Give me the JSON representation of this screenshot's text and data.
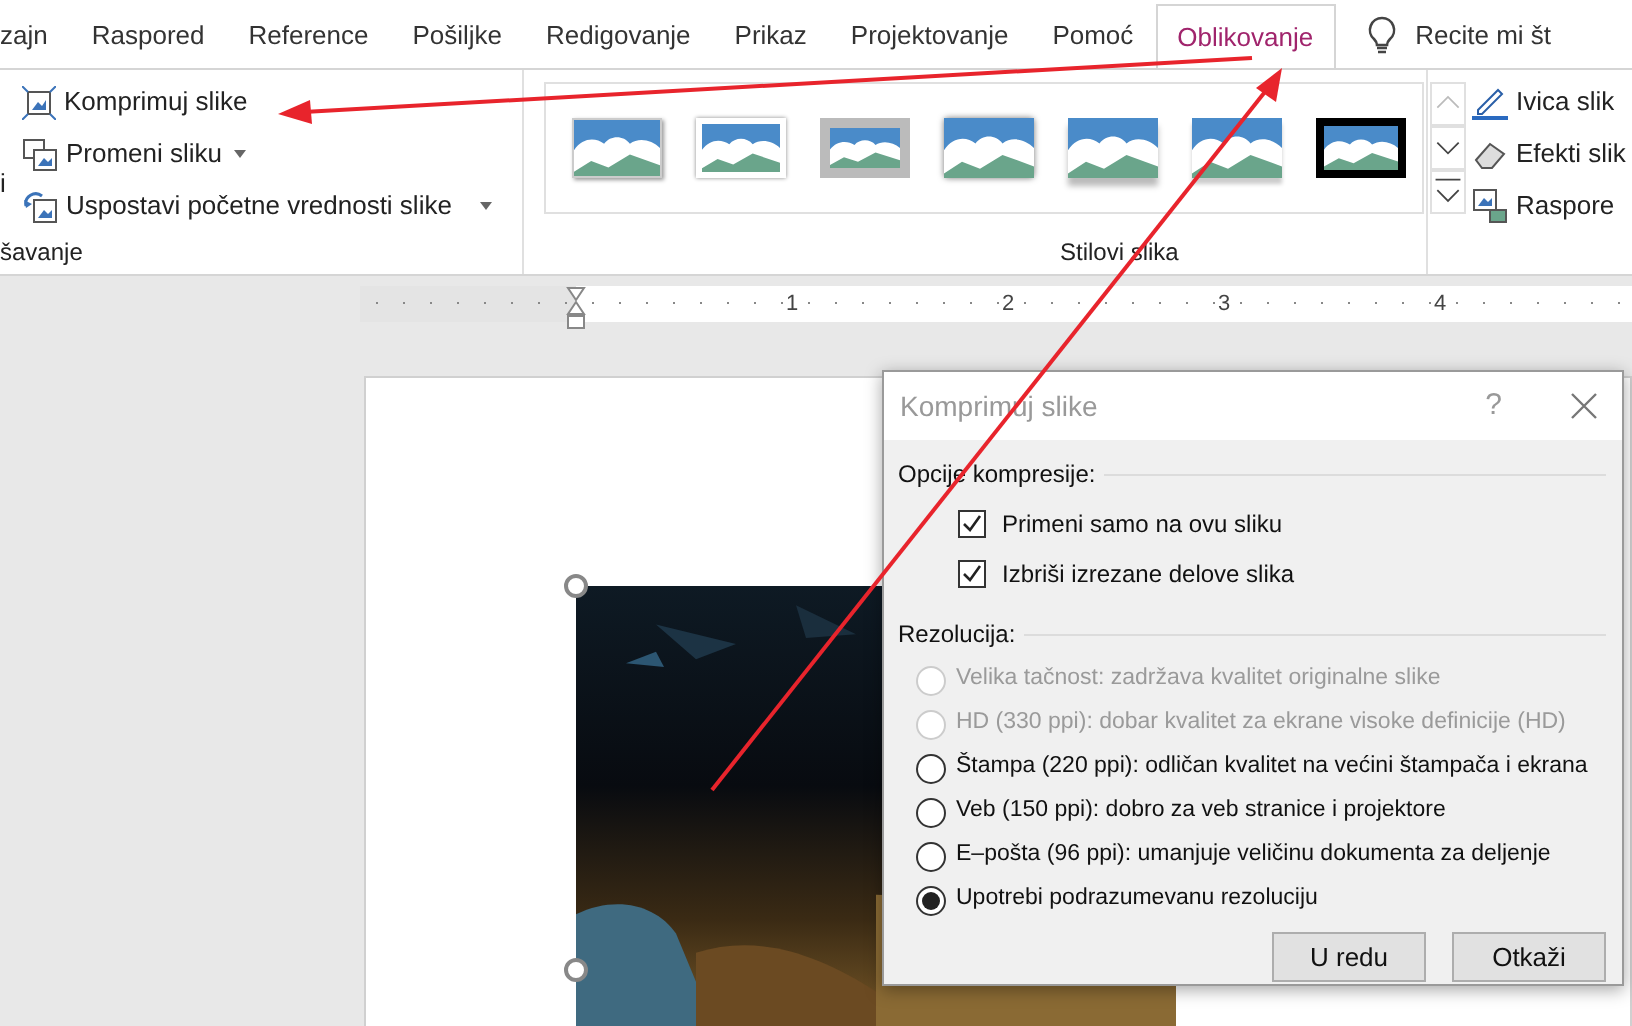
{
  "tabs": [
    {
      "label": "zajn",
      "selected": false
    },
    {
      "label": "Raspored",
      "selected": false
    },
    {
      "label": "Reference",
      "selected": false
    },
    {
      "label": "Pošiljke",
      "selected": false
    },
    {
      "label": "Redigovanje",
      "selected": false
    },
    {
      "label": "Prikaz",
      "selected": false
    },
    {
      "label": "Projektovanje",
      "selected": false
    },
    {
      "label": "Pomoć",
      "selected": false
    },
    {
      "label": "Oblikovanje",
      "selected": true
    }
  ],
  "tell_me": "Recite mi št",
  "ribbon": {
    "cut_label": "i",
    "adjust_group": {
      "label": "šavanje",
      "commands": [
        {
          "label": "Komprimuj slike",
          "dropdown": false
        },
        {
          "label": "Promeni sliku",
          "dropdown": true
        },
        {
          "label": "Uspostavi početne vrednosti slike",
          "dropdown": true
        }
      ]
    },
    "styles_group": {
      "label": "Stilovi slika"
    },
    "picture_commands": [
      "Ivica slik",
      "Efekti slik",
      "Raspore"
    ]
  },
  "ruler": [
    "1",
    "2",
    "3",
    "4"
  ],
  "dialog": {
    "title": "Komprimuj slike",
    "help": "?",
    "compression_label": "Opcije kompresije:",
    "checkboxes": [
      {
        "label": "Primeni samo na ovu sliku",
        "checked": true
      },
      {
        "label": "Izbriši izrezane delove slika",
        "checked": true
      }
    ],
    "resolution_label": "Rezolucija:",
    "radios": [
      {
        "label": "Velika tačnost: zadržava kvalitet originalne slike",
        "selected": false,
        "disabled": true
      },
      {
        "label": "HD (330 ppi): dobar kvalitet za ekrane visoke definicije (HD)",
        "selected": false,
        "disabled": true
      },
      {
        "label": "Štampa (220 ppi): odličan kvalitet na većini štampača i ekrana",
        "selected": false,
        "disabled": false
      },
      {
        "label": "Veb (150 ppi): dobro za veb stranice i projektore",
        "selected": false,
        "disabled": false
      },
      {
        "label": "E–pošta (96 ppi): umanjuje veličinu dokumenta za deljenje",
        "selected": false,
        "disabled": false
      },
      {
        "label": "Upotrebi podrazumevanu rezoluciju",
        "selected": true,
        "disabled": false
      }
    ],
    "buttons": [
      "U redu",
      "Otkaži"
    ]
  }
}
